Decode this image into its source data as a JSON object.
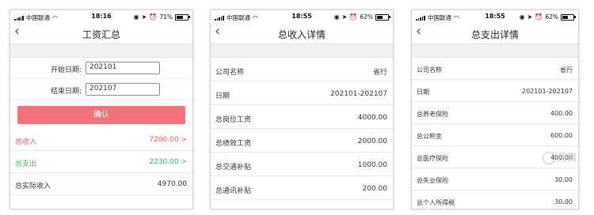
{
  "colors": {
    "accent": "#f3737a",
    "income": "#e4585e",
    "expense": "#41b36b"
  },
  "screen1": {
    "status": {
      "carrier": "中国联通",
      "time": "18:16",
      "battery": "71%",
      "battery_level": 0.71
    },
    "title": "工资汇总",
    "start_label": "开始日期:",
    "start_value": "202101",
    "end_label": "结束日期:",
    "end_value": "202107",
    "confirm_label": "确认",
    "rows": [
      {
        "label": "总收入",
        "value": "7200.00 >"
      },
      {
        "label": "总支出",
        "value": "2230.00 >"
      },
      {
        "label": "总实际收入",
        "value": "4970.00"
      }
    ]
  },
  "screen2": {
    "status": {
      "carrier": "中国联通",
      "time": "18:55",
      "battery": "62%",
      "battery_level": 0.62
    },
    "title": "总收入详情",
    "rows": [
      {
        "label": "公司名称",
        "value": "省行"
      },
      {
        "label": "日期",
        "value": "202101-202107"
      },
      {
        "label": "总岗位工资",
        "value": "4000.00"
      },
      {
        "label": "总绩效工资",
        "value": "2000.00"
      },
      {
        "label": "总交通补贴",
        "value": "1000.00"
      },
      {
        "label": "总通讯补贴",
        "value": "200.00"
      }
    ]
  },
  "screen3": {
    "status": {
      "carrier": "中国联通",
      "time": "18:55",
      "battery": "62%",
      "battery_level": 0.62
    },
    "title": "总支出详情",
    "rows": [
      {
        "label": "公司名称",
        "value": "省行"
      },
      {
        "label": "日期",
        "value": "202101-202107"
      },
      {
        "label": "总养老保险",
        "value": "400.00"
      },
      {
        "label": "总公积金",
        "value": "600.00"
      },
      {
        "label": "总医疗保险",
        "value": "400.00"
      },
      {
        "label": "总失业保险",
        "value": "30.00"
      },
      {
        "label": "总个人所得税",
        "value": "30.00"
      }
    ]
  },
  "watermark": "美篇"
}
